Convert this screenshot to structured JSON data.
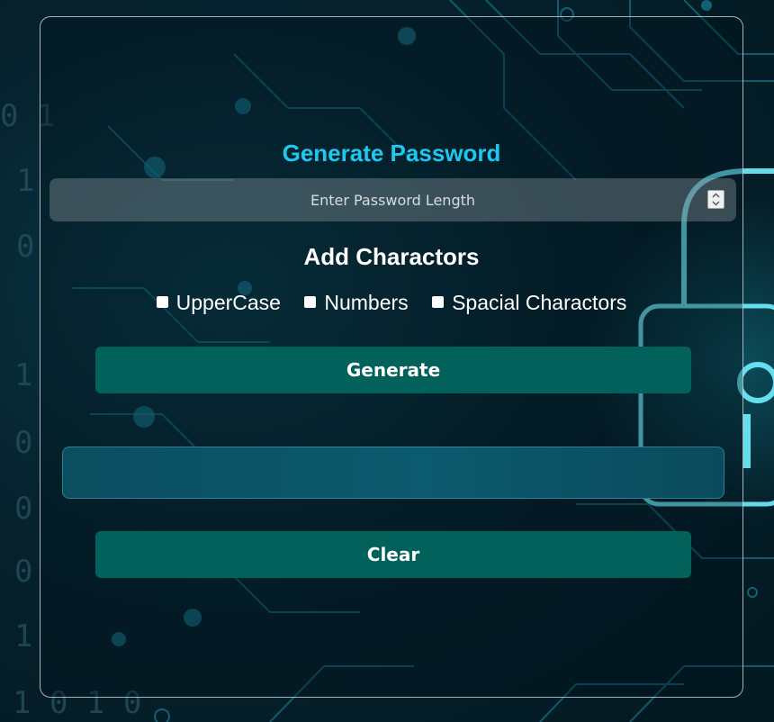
{
  "card": {
    "title": "Generate Password",
    "length_input": {
      "placeholder": "Enter Password Length",
      "value": ""
    },
    "subtitle": "Add Charactors",
    "options": [
      {
        "label": "UpperCase",
        "checked": false
      },
      {
        "label": "Numbers",
        "checked": false
      },
      {
        "label": "Spacial Charactors",
        "checked": false
      }
    ],
    "generate_label": "Generate",
    "output_value": "",
    "clear_label": "Clear"
  },
  "colors": {
    "title": "#1ec8ee",
    "button": "#02615a",
    "output": "#0c5a6e",
    "background": "#06222e"
  },
  "background": {
    "icon": "circuit-board-lock-icon"
  }
}
